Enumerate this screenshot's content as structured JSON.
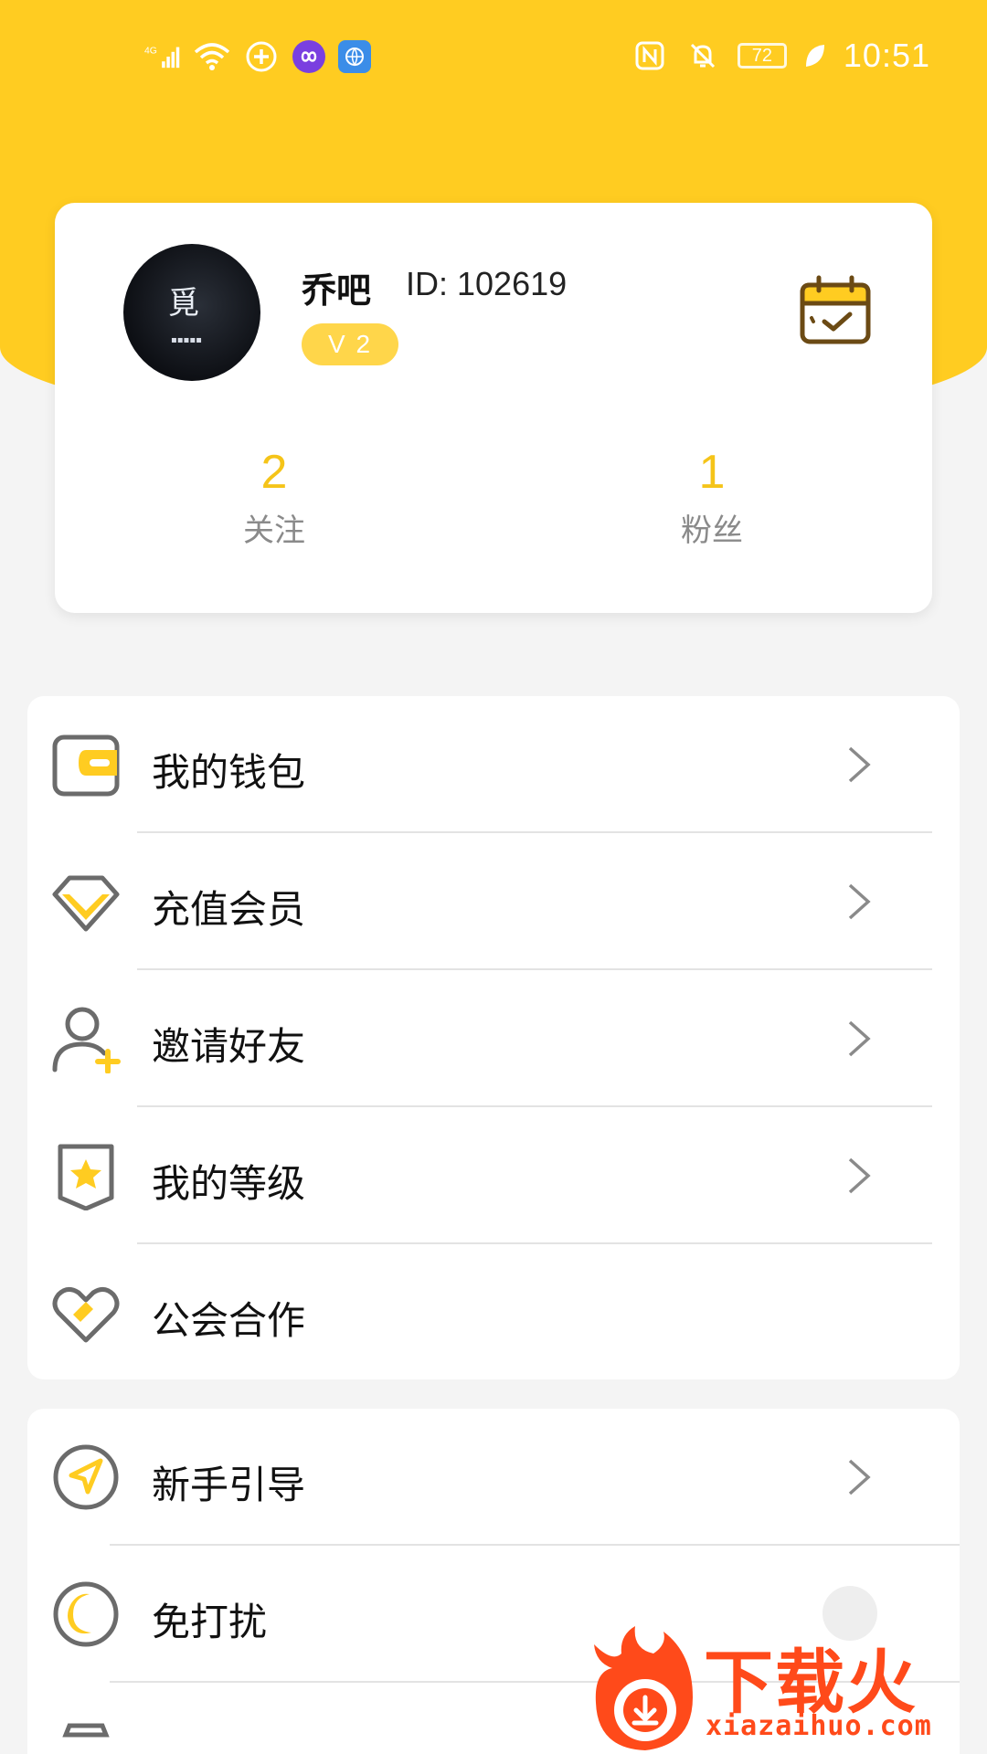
{
  "status_bar": {
    "network": "4G",
    "battery": "72",
    "time": "10:51"
  },
  "profile": {
    "name": "乔吧",
    "id_text": "ID: 102619",
    "level": "V 2",
    "avatar_sign": "覓"
  },
  "stats": [
    {
      "value": "2",
      "label": "关注"
    },
    {
      "value": "1",
      "label": "粉丝"
    }
  ],
  "menu_group_1": [
    {
      "label": "我的钱包",
      "icon": "wallet-icon"
    },
    {
      "label": "充值会员",
      "icon": "diamond-icon"
    },
    {
      "label": "邀请好友",
      "icon": "add-user-icon"
    },
    {
      "label": "我的等级",
      "icon": "level-badge-icon"
    },
    {
      "label": "公会合作",
      "icon": "heart-icon"
    }
  ],
  "menu_group_2": [
    {
      "label": "新手引导",
      "icon": "navigation-icon"
    },
    {
      "label": "免打扰",
      "icon": "moon-icon"
    }
  ],
  "watermark": {
    "title": "下载火",
    "url": "xiazaihuo.com"
  },
  "colors": {
    "brand_yellow": "#ffcc21",
    "accent_yellow": "#f5c419",
    "icon_gray": "#6b6b6b"
  }
}
